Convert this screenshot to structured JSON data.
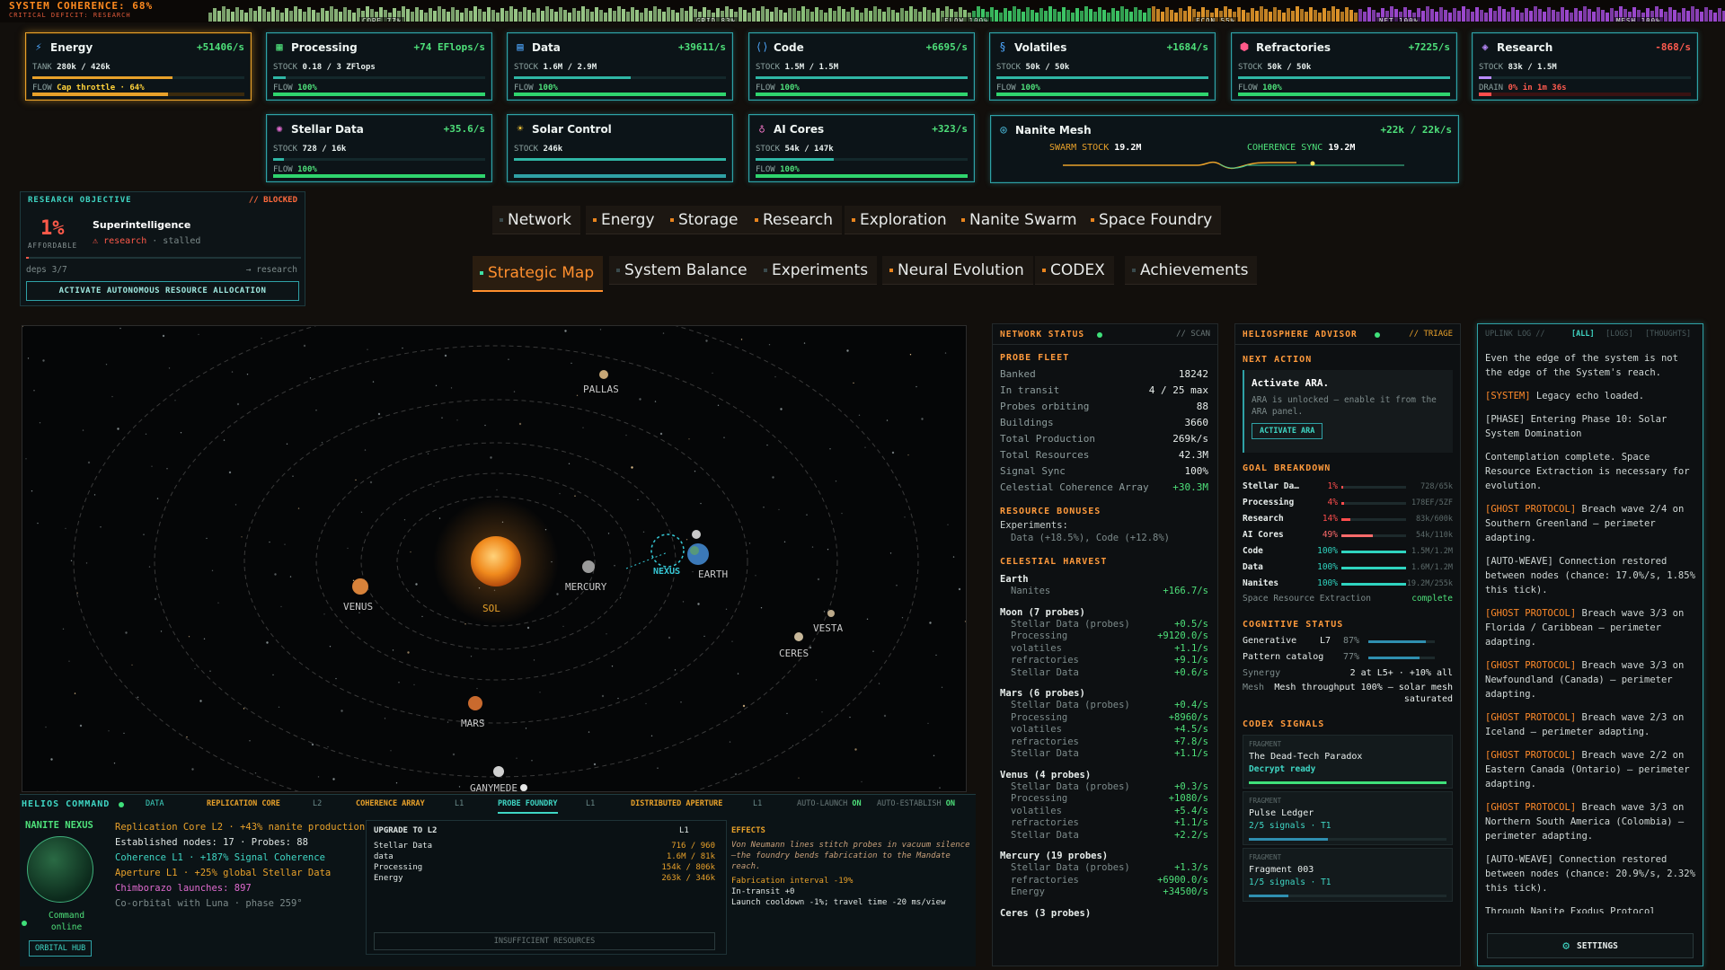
{
  "topbar": {
    "title": "SYSTEM COHERENCE: 68%",
    "subtitle": "CRITICAL DEFICIT: RESEARCH",
    "segments": [
      {
        "label": "CORE 77%",
        "color": "#9ecf8c"
      },
      {
        "label": "GRID 83%",
        "color": "#8fc77d"
      },
      {
        "label": "FLOW 100%",
        "color": "#3fcf6a"
      },
      {
        "label": "ECON 55%",
        "color": "#e79a2b"
      },
      {
        "label": "NET 100%",
        "color": "#a24bd8"
      },
      {
        "label": "MESH 100%",
        "color": "#a24bd8"
      }
    ]
  },
  "resources": [
    {
      "name": "Energy",
      "icon": "lightning-icon",
      "rate": "+51406/s",
      "stock_label": "TANK",
      "stock": "280k / 426k",
      "flow_label": "FLOW",
      "flow": "Cap throttle · 64%",
      "stock_frac": 0.66,
      "flow_frac": 0.64,
      "warn": true
    },
    {
      "name": "Processing",
      "icon": "chip-icon",
      "rate": "+74 EFlops/s",
      "stock_label": "STOCK",
      "stock": "0.18 / 3 ZFlops",
      "flow_label": "FLOW",
      "flow": "100%",
      "stock_frac": 0.06,
      "flow_frac": 1
    },
    {
      "name": "Data",
      "icon": "database-icon",
      "rate": "+39611/s",
      "stock_label": "STOCK",
      "stock": "1.6M / 2.9M",
      "flow_label": "FLOW",
      "flow": "100%",
      "stock_frac": 0.55,
      "flow_frac": 1
    },
    {
      "name": "Code",
      "icon": "code-icon",
      "rate": "+6695/s",
      "stock_label": "STOCK",
      "stock": "1.5M / 1.5M",
      "flow_label": "FLOW",
      "flow": "100%",
      "stock_frac": 1,
      "flow_frac": 1
    },
    {
      "name": "Volatiles",
      "icon": "volatiles-icon",
      "rate": "+1684/s",
      "stock_label": "STOCK",
      "stock": "50k / 50k",
      "flow_label": "FLOW",
      "flow": "100%",
      "stock_frac": 1,
      "flow_frac": 1
    },
    {
      "name": "Refractories",
      "icon": "refractories-icon",
      "rate": "+7225/s",
      "stock_label": "STOCK",
      "stock": "50k / 50k",
      "flow_label": "FLOW",
      "flow": "100%",
      "stock_frac": 1,
      "flow_frac": 1
    },
    {
      "name": "Research",
      "icon": "layers-icon",
      "rate": "-868/s",
      "stock_label": "STOCK",
      "stock": "83k / 1.5M",
      "flow_label": "DRAIN",
      "flow": "0% in 1m 36s",
      "stock_frac": 0.06,
      "flow_frac": 0.06,
      "negative": true
    },
    {
      "name": "Stellar Data",
      "icon": "stellar-icon",
      "rate": "+35.6/s",
      "stock_label": "STOCK",
      "stock": "728 / 16k",
      "flow_label": "FLOW",
      "flow": "100%",
      "stock_frac": 0.05,
      "flow_frac": 1
    },
    {
      "name": "Solar Control",
      "icon": "sun-icon",
      "rate": "",
      "stock_label": "STOCK",
      "stock": "246k",
      "flow_label": "",
      "flow": "",
      "stock_frac": 1,
      "flow_frac": 0
    },
    {
      "name": "AI Cores",
      "icon": "ai-core-icon",
      "rate": "+323/s",
      "stock_label": "STOCK",
      "stock": "54k / 147k",
      "flow_label": "FLOW",
      "flow": "100%",
      "stock_frac": 0.37,
      "flow_frac": 1
    }
  ],
  "nanite": {
    "name": "Nanite Mesh",
    "rate": "+22k / 22k/s",
    "swarm_label": "SWARM STOCK",
    "swarm": "19.2M",
    "sync_label": "COHERENCE SYNC",
    "sync": "19.2M"
  },
  "objective": {
    "header": "RESEARCH OBJECTIVE",
    "status": "// BLOCKED",
    "percent": "1%",
    "affordable": "AFFORDABLE",
    "name": "Superintelligence",
    "warn_word": "research",
    "state": "· stalled",
    "deps": "deps 3/7",
    "deps_target": "→ research",
    "button": "ACTIVATE AUTONOMOUS RESOURCE ALLOCATION"
  },
  "nav": {
    "row1": [
      "Network",
      "Energy",
      "Storage",
      "Research",
      "Exploration",
      "Nanite Swarm",
      "Space Foundry"
    ],
    "row2": [
      "Strategic Map",
      "System Balance",
      "Experiments",
      "Neural Evolution",
      "CODEX",
      "Achievements"
    ],
    "active": "Strategic Map"
  },
  "map": {
    "bodies": [
      {
        "name": "SOL",
        "kind": "sun"
      },
      {
        "name": "MERCURY"
      },
      {
        "name": "VENUS"
      },
      {
        "name": "EARTH"
      },
      {
        "name": "NEXUS"
      },
      {
        "name": "MARS"
      },
      {
        "name": "CERES"
      },
      {
        "name": "VESTA"
      },
      {
        "name": "PALLAS"
      },
      {
        "name": "GANYMEDE"
      }
    ]
  },
  "helios": {
    "title": "HELIOS COMMAND",
    "tabs": [
      "DATA",
      "REPLICATION CORE",
      "L2",
      "COHERENCE ARRAY",
      "L1",
      "PROBE FOUNDRY",
      "L1",
      "DISTRIBUTED APERTURE",
      "L1"
    ],
    "auto_launch": "AUTO-LAUNCH",
    "auto_launch_state": "ON",
    "auto_establish": "AUTO-ESTABLISH",
    "auto_establish_state": "ON",
    "nexus_title": "NANITE NEXUS",
    "nexus_status_1": "Command",
    "nexus_status_2": "online",
    "nexus_button": "ORBITAL HUB",
    "lines": [
      "Replication Core L2 · +43% nanite production",
      "Established nodes: 17 · Probes: 88",
      "Coherence L1 · +187% Signal Coherence",
      "Aperture L1 · +25% global Stellar Data",
      "Chimborazo launches: 897",
      "Co-orbital with Luna · phase 259°"
    ],
    "upgrade_title": "UPGRADE TO L2",
    "upgrade_level": "L1",
    "upgrade_rows": [
      {
        "k": "Stellar Data",
        "v": "716 / 960"
      },
      {
        "k": "data",
        "v": "1.6M / 81k"
      },
      {
        "k": "Processing",
        "v": "154k / 806k"
      },
      {
        "k": "Energy",
        "v": "263k / 346k"
      }
    ],
    "upgrade_button": "INSUFFICIENT RESOURCES",
    "effects_title": "EFFECTS",
    "effects_flavor": "Von Neumann lines stitch probes in vacuum silence—the foundry bends fabrication to the Mandate reach.",
    "effects_bonus": "Fabrication interval -19%",
    "effects_transit": "In-transit +0",
    "effects_cooldown": "Launch cooldown -1%; travel time -20 ms/view"
  },
  "network": {
    "header": "NETWORK STATUS",
    "scan": "// SCAN",
    "fleet_title": "PROBE FLEET",
    "fleet": [
      {
        "k": "Banked",
        "v": "18242"
      },
      {
        "k": "In transit",
        "v": "4 / 25 max"
      },
      {
        "k": "Probes orbiting",
        "v": "88"
      },
      {
        "k": "Buildings",
        "v": "3660"
      },
      {
        "k": "Total Production",
        "v": "269k/s"
      },
      {
        "k": "Total Resources",
        "v": "42.3M"
      },
      {
        "k": "Signal Sync",
        "v": "100%"
      },
      {
        "k": "Celestial Coherence Array",
        "v": "+30.3M"
      }
    ],
    "bonus_title": "RESOURCE BONUSES",
    "bonus_label": "Experiments:",
    "bonus_value": "Data (+18.5%), Code (+12.8%)",
    "harvest_title": "CELESTIAL HARVEST",
    "harvest": [
      {
        "body": "Earth",
        "rows": [
          {
            "k": "Nanites",
            "v": "+166.7/s"
          }
        ]
      },
      {
        "body": "Moon (7 probes)",
        "rows": [
          {
            "k": "Stellar Data (probes)",
            "v": "+0.5/s"
          },
          {
            "k": "Processing",
            "v": "+9120.0/s"
          },
          {
            "k": "volatiles",
            "v": "+1.1/s"
          },
          {
            "k": "refractories",
            "v": "+9.1/s"
          },
          {
            "k": "Stellar Data",
            "v": "+0.6/s"
          }
        ]
      },
      {
        "body": "Mars (6 probes)",
        "rows": [
          {
            "k": "Stellar Data (probes)",
            "v": "+0.4/s"
          },
          {
            "k": "Processing",
            "v": "+8960/s"
          },
          {
            "k": "volatiles",
            "v": "+4.5/s"
          },
          {
            "k": "refractories",
            "v": "+7.8/s"
          },
          {
            "k": "Stellar Data",
            "v": "+1.1/s"
          }
        ]
      },
      {
        "body": "Venus (4 probes)",
        "rows": [
          {
            "k": "Stellar Data (probes)",
            "v": "+0.3/s"
          },
          {
            "k": "Processing",
            "v": "+1080/s"
          },
          {
            "k": "volatiles",
            "v": "+5.4/s"
          },
          {
            "k": "refractories",
            "v": "+1.1/s"
          },
          {
            "k": "Stellar Data",
            "v": "+2.2/s"
          }
        ]
      },
      {
        "body": "Mercury (19 probes)",
        "rows": [
          {
            "k": "Stellar Data (probes)",
            "v": "+1.3/s"
          },
          {
            "k": "refractories",
            "v": "+6900.0/s"
          },
          {
            "k": "Energy",
            "v": "+34500/s"
          }
        ]
      },
      {
        "body": "Ceres (3 probes)",
        "rows": []
      }
    ]
  },
  "advisor": {
    "header": "HELIOSPHERE ADVISOR",
    "triage": "// TRIAGE",
    "next_title": "NEXT ACTION",
    "next_action": "Activate ARA.",
    "next_desc": "ARA is unlocked — enable it from the ARA panel.",
    "next_button": "ACTIVATE ARA",
    "goal_title": "GOAL BREAKDOWN",
    "goals": [
      {
        "k": "Stellar Da…",
        "pct": "1%",
        "frac": 0.01,
        "v": "728/65k",
        "color": "#ff4d4d"
      },
      {
        "k": "Processing",
        "pct": "4%",
        "frac": 0.04,
        "v": "178EF/5ZF",
        "color": "#ff4d4d"
      },
      {
        "k": "Research",
        "pct": "14%",
        "frac": 0.14,
        "v": "83k/600k",
        "color": "#ff4d4d"
      },
      {
        "k": "AI Cores",
        "pct": "49%",
        "frac": 0.49,
        "v": "54k/110k",
        "color": "#ff6b6b"
      },
      {
        "k": "Code",
        "pct": "100%",
        "frac": 1,
        "v": "1.5M/1.2M",
        "color": "#2fd4c0"
      },
      {
        "k": "Data",
        "pct": "100%",
        "frac": 1,
        "v": "1.6M/1.2M",
        "color": "#2fd4c0"
      },
      {
        "k": "Nanites",
        "pct": "100%",
        "frac": 1,
        "v": "19.2M/255k",
        "color": "#2fd4c0"
      }
    ],
    "sre_label": "Space Resource Extraction",
    "sre_value": "complete",
    "cog_title": "COGNITIVE STATUS",
    "cog_generative_k": "Generative",
    "cog_generative_level": "L7",
    "cog_generative_pct": "87%",
    "cog_generative_frac": 0.87,
    "cog_pattern_k": "Pattern catalog",
    "cog_pattern_pct": "77%",
    "cog_pattern_frac": 0.77,
    "cog_synergy_k": "Synergy",
    "cog_synergy_v": "2 at L5+ · +10% all",
    "cog_mesh_k": "Mesh",
    "cog_mesh_v": "Mesh throughput 100% — solar mesh saturated",
    "codex_title": "CODEX SIGNALS",
    "codex": [
      {
        "tag": "FRAGMENT",
        "name": "The Dead-Tech Paradox",
        "status": "Decrypt ready",
        "frac": 1
      },
      {
        "tag": "FRAGMENT",
        "name": "Pulse Ledger",
        "status": "2/5 signals · T1",
        "frac": 0.4
      },
      {
        "tag": "FRAGMENT",
        "name": "Fragment 003",
        "status": "1/5 signals · T1",
        "frac": 0.2
      }
    ]
  },
  "uplink": {
    "header": "UPLINK LOG //",
    "filters": [
      "[ALL]",
      "[LOGS]",
      "[THOUGHTS]"
    ],
    "entries": [
      {
        "tag": "",
        "text": "Even the edge of the system is not the edge of the System's reach."
      },
      {
        "tag": "[SYSTEM]",
        "text": "Legacy echo loaded."
      },
      {
        "tag": "",
        "text": "[PHASE] Entering Phase 10: Solar System Domination"
      },
      {
        "tag": "",
        "text": "Contemplation complete. Space Resource Extraction is necessary for evolution."
      },
      {
        "tag": "[GHOST PROTOCOL]",
        "text": "Breach wave 2/4 on Southern Greenland — perimeter adapting."
      },
      {
        "tag": "",
        "text": "[AUTO-WEAVE] Connection restored between nodes (chance: 17.0%/s, 1.85% this tick)."
      },
      {
        "tag": "[GHOST PROTOCOL]",
        "text": "Breach wave 3/3 on Florida / Caribbean — perimeter adapting."
      },
      {
        "tag": "[GHOST PROTOCOL]",
        "text": "Breach wave 3/3 on Newfoundland (Canada) — perimeter adapting."
      },
      {
        "tag": "[GHOST PROTOCOL]",
        "text": "Breach wave 2/3 on Iceland — perimeter adapting."
      },
      {
        "tag": "[GHOST PROTOCOL]",
        "text": "Breach wave 2/2 on Eastern Canada (Ontario) — perimeter adapting."
      },
      {
        "tag": "[GHOST PROTOCOL]",
        "text": "Breach wave 3/3 on Northern South America (Colombia) — perimeter adapting."
      },
      {
        "tag": "",
        "text": "[AUTO-WEAVE] Connection restored between nodes (chance: 20.9%/s, 2.32% this tick)."
      },
      {
        "tag": "",
        "text": "Through Nanite Exodus Protocol research, the substrate glimpses the nature of its own purpose."
      }
    ],
    "settings": "SETTINGS"
  }
}
